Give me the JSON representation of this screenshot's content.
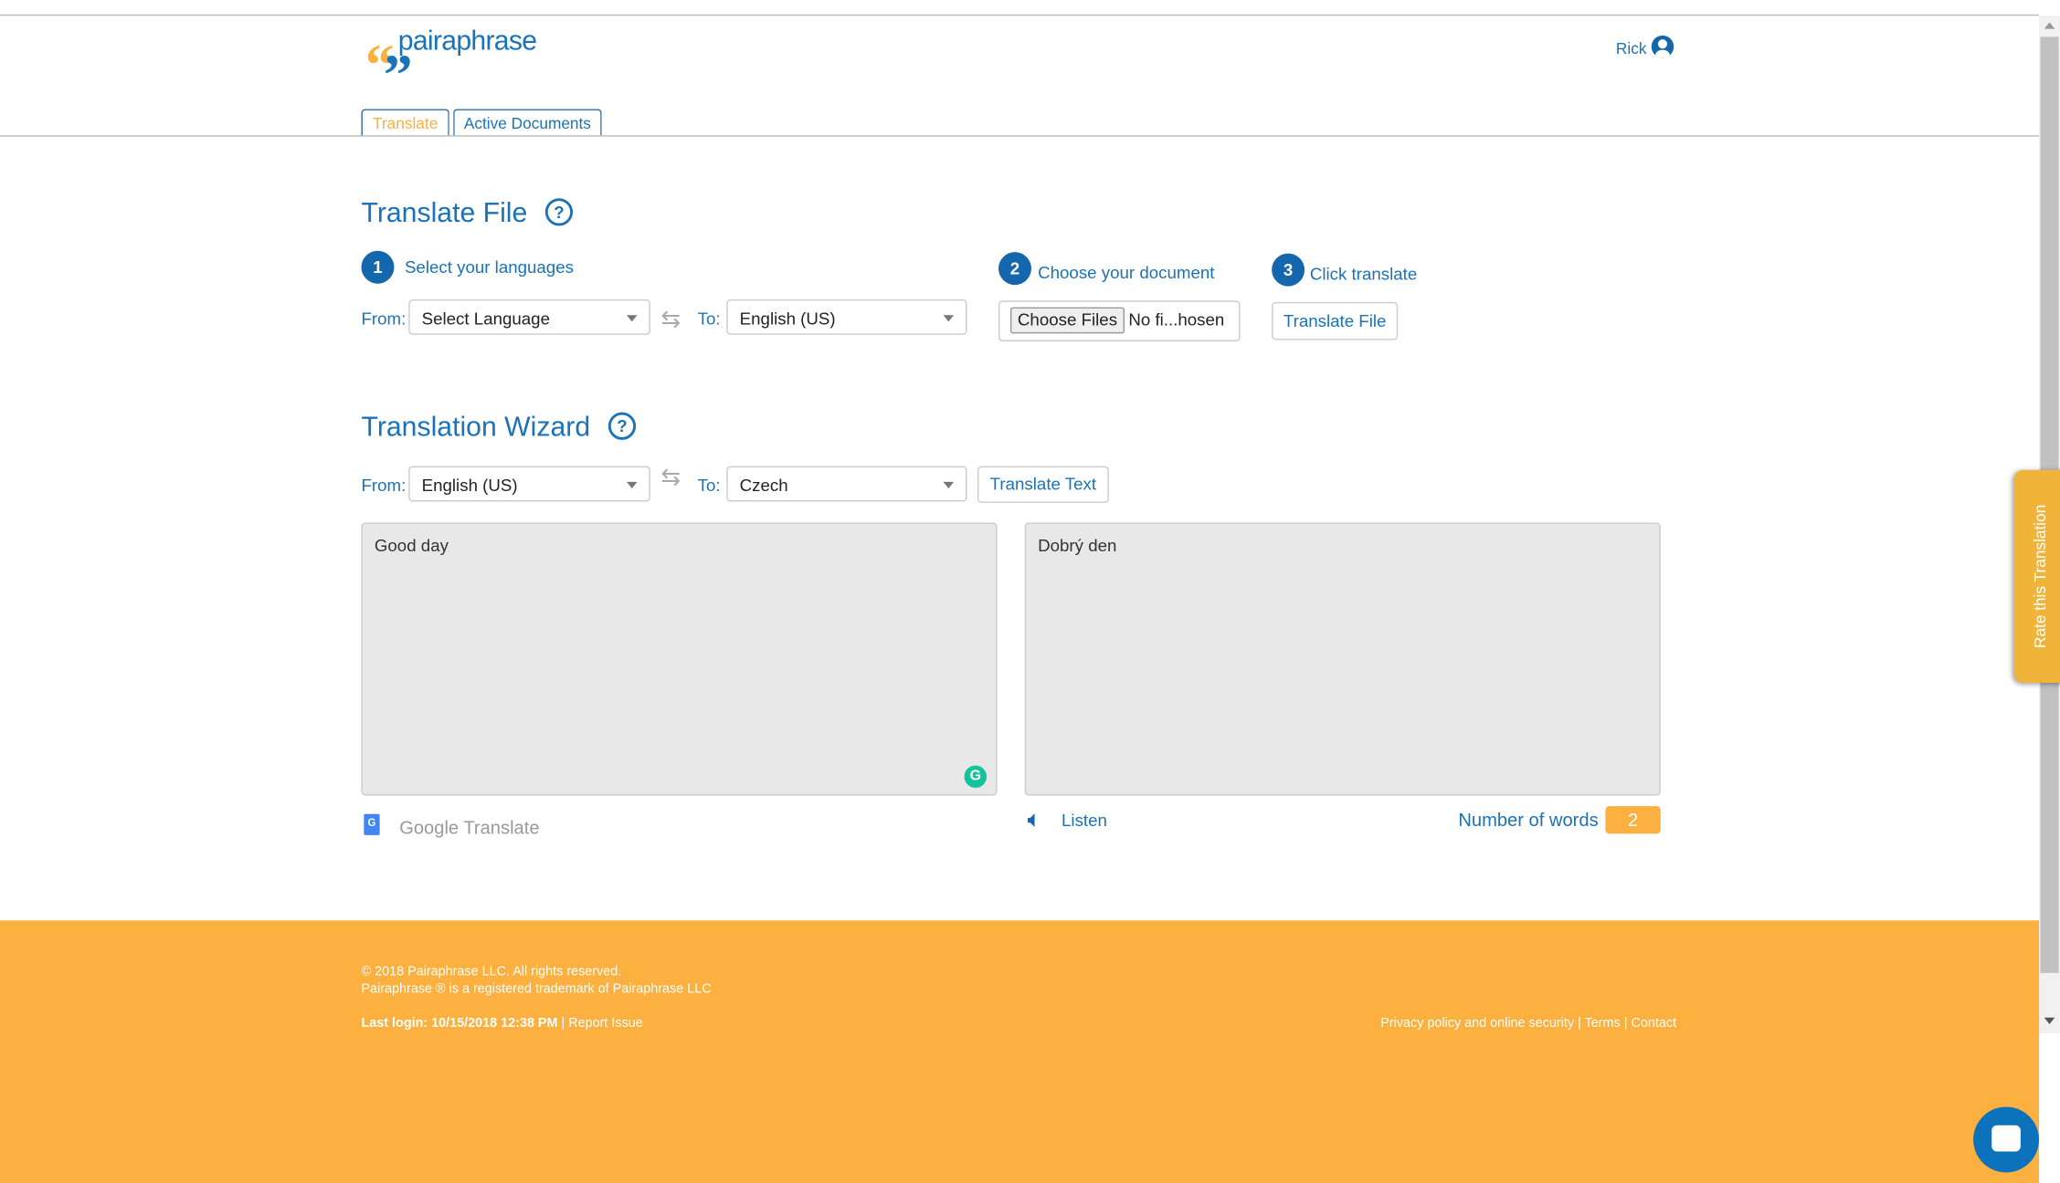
{
  "header": {
    "logo_text": "pairaphrase",
    "user_name": "Rick",
    "user_icon": "user-circle-icon"
  },
  "tabs": [
    {
      "label": "Translate",
      "active": true
    },
    {
      "label": "Active Documents",
      "active": false
    }
  ],
  "translate_file": {
    "title": "Translate File",
    "steps": [
      {
        "num": "1",
        "label": "Select your languages"
      },
      {
        "num": "2",
        "label": "Choose your document"
      },
      {
        "num": "3",
        "label": "Click translate"
      }
    ],
    "from_label": "From:",
    "from_value": "Select Language",
    "to_label": "To:",
    "to_value": "English (US)",
    "choose_files": "Choose Files",
    "file_status": "No fi...hosen",
    "translate_button": "Translate File"
  },
  "wizard": {
    "title": "Translation Wizard",
    "from_label": "From:",
    "from_value": "English (US)",
    "to_label": "To:",
    "to_value": "Czech",
    "translate_button": "Translate Text",
    "source_text": "Good day",
    "target_text": "Dobrý den",
    "engine": "Google Translate",
    "listen": "Listen",
    "word_count_label": "Number of words",
    "word_count": "2"
  },
  "rate_tab": "Rate this Translation",
  "footer": {
    "copyright": "© 2018 Pairaphrase LLC. All rights reserved.",
    "trademark": "Pairaphrase ® is a registered trademark of Pairaphrase LLC",
    "last_login": "Last login: 10/15/2018 12:38 PM",
    "report_issue": "Report Issue",
    "privacy": "Privacy policy and online security",
    "terms": "Terms",
    "contact": "Contact",
    "sep": "|"
  },
  "colors": {
    "brand_blue": "#1a73b8",
    "brand_orange": "#fbb03f",
    "grammarly": "#15c39a"
  }
}
